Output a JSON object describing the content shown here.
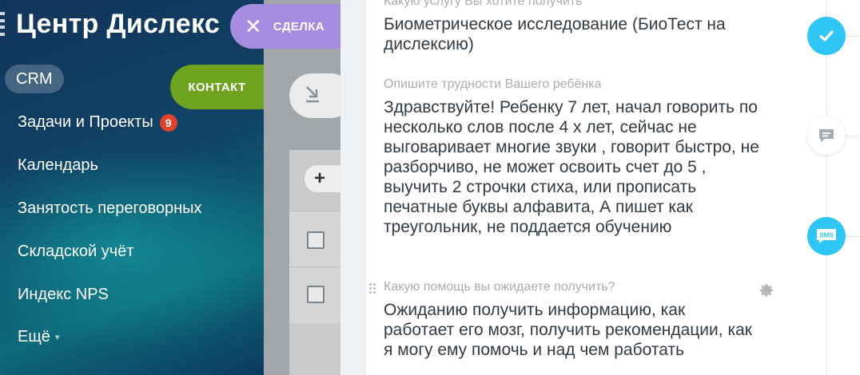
{
  "sidebar": {
    "app_title": "Центр Дислекс",
    "items": [
      {
        "label": "CRM"
      },
      {
        "label": "Задачи и Проекты",
        "badge": "9"
      },
      {
        "label": "Календарь"
      },
      {
        "label": "Занятость переговорных"
      },
      {
        "label": "Складской учёт"
      },
      {
        "label": "Индекс NPS"
      },
      {
        "label": "Ещё"
      }
    ]
  },
  "slider_tabs": {
    "deal_label": "СДЕЛКА",
    "contact_label": "КОНТАКТ"
  },
  "fields": [
    {
      "label": "Какую услугу Вы хотите получить",
      "value": "Биометрическое исследование (БиоТест на дислексию)"
    },
    {
      "label": "Опишите трудности Вашего ребёнка",
      "value": "Здравствуйте! Ребенку 7 лет, начал говорить по несколько слов после 4 х лет, сейчас не выговаривает многие звуки , говорит быстро, не разборчиво, не может освоить счет до 5 , выучить 2 строчки стиха, или прописать печатные буквы алфавита, А пишет как треугольник, не поддается обучению"
    },
    {
      "label": "Какую помощь вы ожидаете получить?",
      "value": "Ожиданию получить информацию, как работает его мозг, получить рекомендации, как я могу ему помочь и над чем работать"
    }
  ],
  "rail": {
    "sms_label": "SMS"
  },
  "colors": {
    "accent_blue": "#2fc6f6",
    "deal_purple": "#a58ce0",
    "contact_green": "#6ea21f",
    "badge_red": "#e0412b"
  },
  "icons": {
    "close": "close-icon",
    "check": "check-icon",
    "comment": "comment-icon",
    "sms": "sms-icon",
    "gear": "gear-icon",
    "drag": "drag-handle-icon",
    "collapse": "collapse-arrow-icon",
    "add": "plus-icon"
  }
}
